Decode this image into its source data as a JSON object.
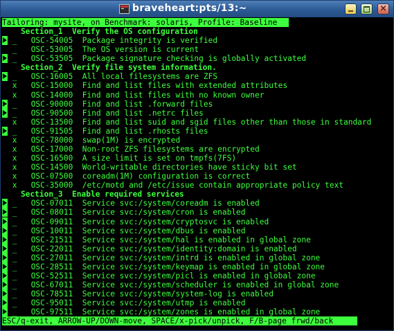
{
  "window": {
    "title": "braveheart:pts/13:~"
  },
  "header": "Tailoring: mysite, on Benchmark: solaris, Profile: Baseline",
  "footer": "ESC/q-exit, ARROW-UP/DOWN-move, SPACE/x-pick/unpick, F/B-page frwd/back",
  "lines": [
    {
      "kind": "section",
      "text": "Section_1  Verify the OS configuration"
    },
    {
      "kind": "rule",
      "cursor": true,
      "pick": "_",
      "id": "OSC-54005",
      "desc": "Package integrity is verified"
    },
    {
      "kind": "rule",
      "cursor": false,
      "pick": "_",
      "id": "OSC-53005",
      "desc": "The OS version is current"
    },
    {
      "kind": "rule",
      "cursor": true,
      "pick": "_",
      "id": "OSC-53505",
      "desc": "Package signature checking is globally activated"
    },
    {
      "kind": "section",
      "text": "Section_2  Verify file system information."
    },
    {
      "kind": "rule",
      "cursor": true,
      "pick": "_",
      "id": "OSC-16005",
      "desc": "All local filesystems are ZFS"
    },
    {
      "kind": "rule",
      "cursor": false,
      "pick": "x",
      "id": "OSC-15000",
      "desc": "Find and list files with extended attributes"
    },
    {
      "kind": "rule",
      "cursor": false,
      "pick": "x",
      "id": "OSC-14000",
      "desc": "Find and list files with no known owner"
    },
    {
      "kind": "rule",
      "cursor": true,
      "pick": "_",
      "id": "OSC-90000",
      "desc": "Find and list .forward files"
    },
    {
      "kind": "rule",
      "cursor": true,
      "pick": "_",
      "id": "OSC-90500",
      "desc": "Find and list .netrc files"
    },
    {
      "kind": "rule",
      "cursor": false,
      "pick": "x",
      "id": "OSC-13500",
      "desc": "Find and list suid and sgid files other than those in standard"
    },
    {
      "kind": "rule",
      "cursor": true,
      "pick": "_",
      "id": "OSC-91505",
      "desc": "Find and list .rhosts files"
    },
    {
      "kind": "rule",
      "cursor": false,
      "pick": "x",
      "id": "OSC-78000",
      "desc": "swap(1M) is encrypted"
    },
    {
      "kind": "rule",
      "cursor": false,
      "pick": "x",
      "id": "OSC-17000",
      "desc": "Non-root ZFS filesystems are encrypted"
    },
    {
      "kind": "rule",
      "cursor": false,
      "pick": "x",
      "id": "OSC-16500",
      "desc": "A size limit is set on tmpfs(7FS)"
    },
    {
      "kind": "rule",
      "cursor": false,
      "pick": "x",
      "id": "OSC-14500",
      "desc": "World-writable directories have sticky bit set"
    },
    {
      "kind": "rule",
      "cursor": false,
      "pick": "x",
      "id": "OSC-07500",
      "desc": "coreadm(1M) configuration is correct"
    },
    {
      "kind": "rule",
      "cursor": false,
      "pick": "x",
      "id": "OSC-35000",
      "desc": "/etc/motd and /etc/issue contain appropriate policy text"
    },
    {
      "kind": "section",
      "text": "Section_3  Enable required services"
    },
    {
      "kind": "rule",
      "cursor": true,
      "pick": "_",
      "id": "OSC-07011",
      "desc": "Service svc:/system/coreadm is enabled"
    },
    {
      "kind": "rule",
      "cursor": true,
      "pick": "_",
      "id": "OSC-08011",
      "desc": "Service svc:/system/cron is enabled"
    },
    {
      "kind": "rule",
      "cursor": true,
      "pick": "_",
      "id": "OSC-09011",
      "desc": "Service svc:/system/cryptosvc is enabled"
    },
    {
      "kind": "rule",
      "cursor": true,
      "pick": "_",
      "id": "OSC-10011",
      "desc": "Service svc:/system/dbus is enabled"
    },
    {
      "kind": "rule",
      "cursor": true,
      "pick": "_",
      "id": "OSC-21511",
      "desc": "Service svc:/system/hal is enabled in global zone"
    },
    {
      "kind": "rule",
      "cursor": true,
      "pick": "_",
      "id": "OSC-22011",
      "desc": "Service svc:/system/identity:domain is enabled"
    },
    {
      "kind": "rule",
      "cursor": true,
      "pick": "_",
      "id": "OSC-27011",
      "desc": "Service svc:/system/intrd is enabled in global zone"
    },
    {
      "kind": "rule",
      "cursor": true,
      "pick": "_",
      "id": "OSC-28511",
      "desc": "Service svc:/system/keymap is enabled in global zone"
    },
    {
      "kind": "rule",
      "cursor": true,
      "pick": "_",
      "id": "OSC-52511",
      "desc": "Service svc:/system/picl is enabled in global zone"
    },
    {
      "kind": "rule",
      "cursor": true,
      "pick": "_",
      "id": "OSC-67011",
      "desc": "Service svc:/system/scheduler is enabled in global zone"
    },
    {
      "kind": "rule",
      "cursor": true,
      "pick": "_",
      "id": "OSC-78511",
      "desc": "Service svc:/system/system-log is enabled"
    },
    {
      "kind": "rule",
      "cursor": true,
      "pick": "_",
      "id": "OSC-95011",
      "desc": "Service svc:/system/utmp is enabled"
    },
    {
      "kind": "rule",
      "cursor": true,
      "pick": "_",
      "id": "OSC-97511",
      "desc": "Service svc:/system/zones is enabled in global zone"
    }
  ]
}
